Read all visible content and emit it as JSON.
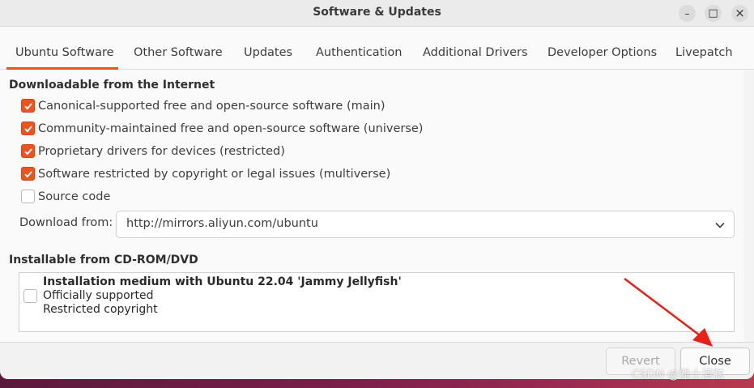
{
  "window": {
    "title": "Software & Updates",
    "controls": {
      "minimize": "–",
      "maximize": "□",
      "close": "×"
    }
  },
  "tabs": [
    {
      "label": "Ubuntu Software",
      "active": true
    },
    {
      "label": "Other Software"
    },
    {
      "label": "Updates"
    },
    {
      "label": "Authentication"
    },
    {
      "label": "Additional Drivers"
    },
    {
      "label": "Developer Options"
    },
    {
      "label": "Livepatch"
    }
  ],
  "internet": {
    "heading": "Downloadable from the Internet",
    "options": [
      {
        "label": "Canonical-supported free and open-source software (main)",
        "checked": true
      },
      {
        "label": "Community-maintained free and open-source software (universe)",
        "checked": true
      },
      {
        "label": "Proprietary drivers for devices (restricted)",
        "checked": true
      },
      {
        "label": "Software restricted by copyright or legal issues (multiverse)",
        "checked": true
      },
      {
        "label": "Source code",
        "checked": false
      }
    ],
    "download_from_label": "Download from:",
    "download_from_value": "http://mirrors.aliyun.com/ubuntu"
  },
  "cdrom": {
    "heading": "Installable from CD-ROM/DVD",
    "item": {
      "title": "Installation medium with Ubuntu 22.04 'Jammy Jellyfish'",
      "line1": "Officially supported",
      "line2": "Restricted copyright",
      "checked": false
    }
  },
  "buttons": {
    "revert": "Revert",
    "close": "Close"
  },
  "watermark": "CSDN @雅士清弦",
  "colors": {
    "accent": "#e95420",
    "annotation_arrow": "#e8201a"
  }
}
